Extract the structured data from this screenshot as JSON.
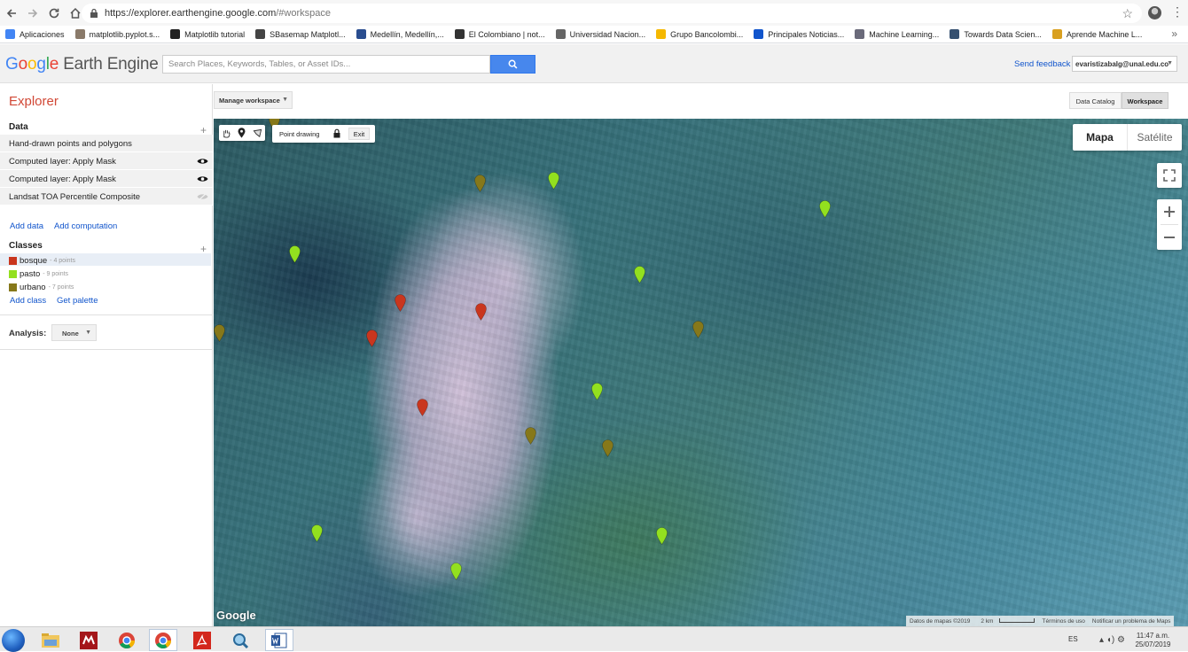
{
  "browser": {
    "url_host": "https://explorer.earthengine.google.com",
    "url_path": "/#workspace",
    "bookmarks": [
      {
        "label": "Aplicaciones",
        "icon": "apps-grid-icon",
        "color": "#4285f4"
      },
      {
        "label": "matplotlib.pyplot.s...",
        "icon": "matplotlib-icon",
        "color": "#8a7a6a"
      },
      {
        "label": "Matplotlib tutorial",
        "icon": "github-icon",
        "color": "#222222"
      },
      {
        "label": "SBasemap Matplotl...",
        "icon": "globe-icon",
        "color": "#444444"
      },
      {
        "label": "Medellín, Medellín,...",
        "icon": "site-icon",
        "color": "#2a4d8f"
      },
      {
        "label": "El Colombiano | not...",
        "icon": "news-icon",
        "color": "#333333"
      },
      {
        "label": "Universidad Nacion...",
        "icon": "unal-icon",
        "color": "#666666"
      },
      {
        "label": "Grupo Bancolombi...",
        "icon": "bancolombia-icon",
        "color": "#f5b800"
      },
      {
        "label": "Principales Noticias...",
        "icon": "et-icon",
        "color": "#1155cc"
      },
      {
        "label": "Machine Learning...",
        "icon": "image-icon",
        "color": "#6a6a7a"
      },
      {
        "label": "Towards Data Scien...",
        "icon": "tds-icon",
        "color": "#355070"
      },
      {
        "label": "Aprende Machine L...",
        "icon": "course-icon",
        "color": "#d9a020"
      }
    ]
  },
  "header": {
    "logo_google": [
      "G",
      "o",
      "o",
      "g",
      "l",
      "e"
    ],
    "logo_rest": " Earth Engine",
    "search_placeholder": "Search Places, Keywords, Tables, or Asset IDs...",
    "send_feedback": "Send feedback",
    "account": "evaristizabalg@unal.edu.co"
  },
  "sidebar": {
    "title": "Explorer",
    "data_title": "Data",
    "data_rows": [
      {
        "label": "Hand-drawn points and polygons",
        "eye": "none"
      },
      {
        "label": "Computed layer: Apply Mask",
        "eye": "visible"
      },
      {
        "label": "Computed layer: Apply Mask",
        "eye": "visible"
      },
      {
        "label": "Landsat TOA Percentile Composite",
        "eye": "hidden"
      }
    ],
    "add_data": "Add data",
    "add_computation": "Add computation",
    "classes_title": "Classes",
    "classes": [
      {
        "name": "bosque",
        "points": "- 4 points",
        "color": "#c9361e"
      },
      {
        "name": "pasto",
        "points": "- 9 points",
        "color": "#93e01f"
      },
      {
        "name": "urbano",
        "points": "- 7 points",
        "color": "#86781a"
      }
    ],
    "add_class": "Add class",
    "get_palette": "Get palette",
    "analysis_label": "Analysis:",
    "analysis_value": "None"
  },
  "workspace": {
    "manage_label": "Manage workspace",
    "tab_catalog": "Data Catalog",
    "tab_workspace": "Workspace"
  },
  "map": {
    "point_drawing": "Point drawing",
    "exit": "Exit",
    "map_type_map": "Mapa",
    "map_type_sat": "Satélite",
    "google_mark": "Google",
    "attribution": [
      "Datos de mapas ©2019",
      "2 km",
      "Términos de uso",
      "Notificar un problema de Maps"
    ]
  },
  "taskbar": {
    "lang": "ES",
    "time": "11:47 a.m.",
    "date": "25/07/2019"
  }
}
